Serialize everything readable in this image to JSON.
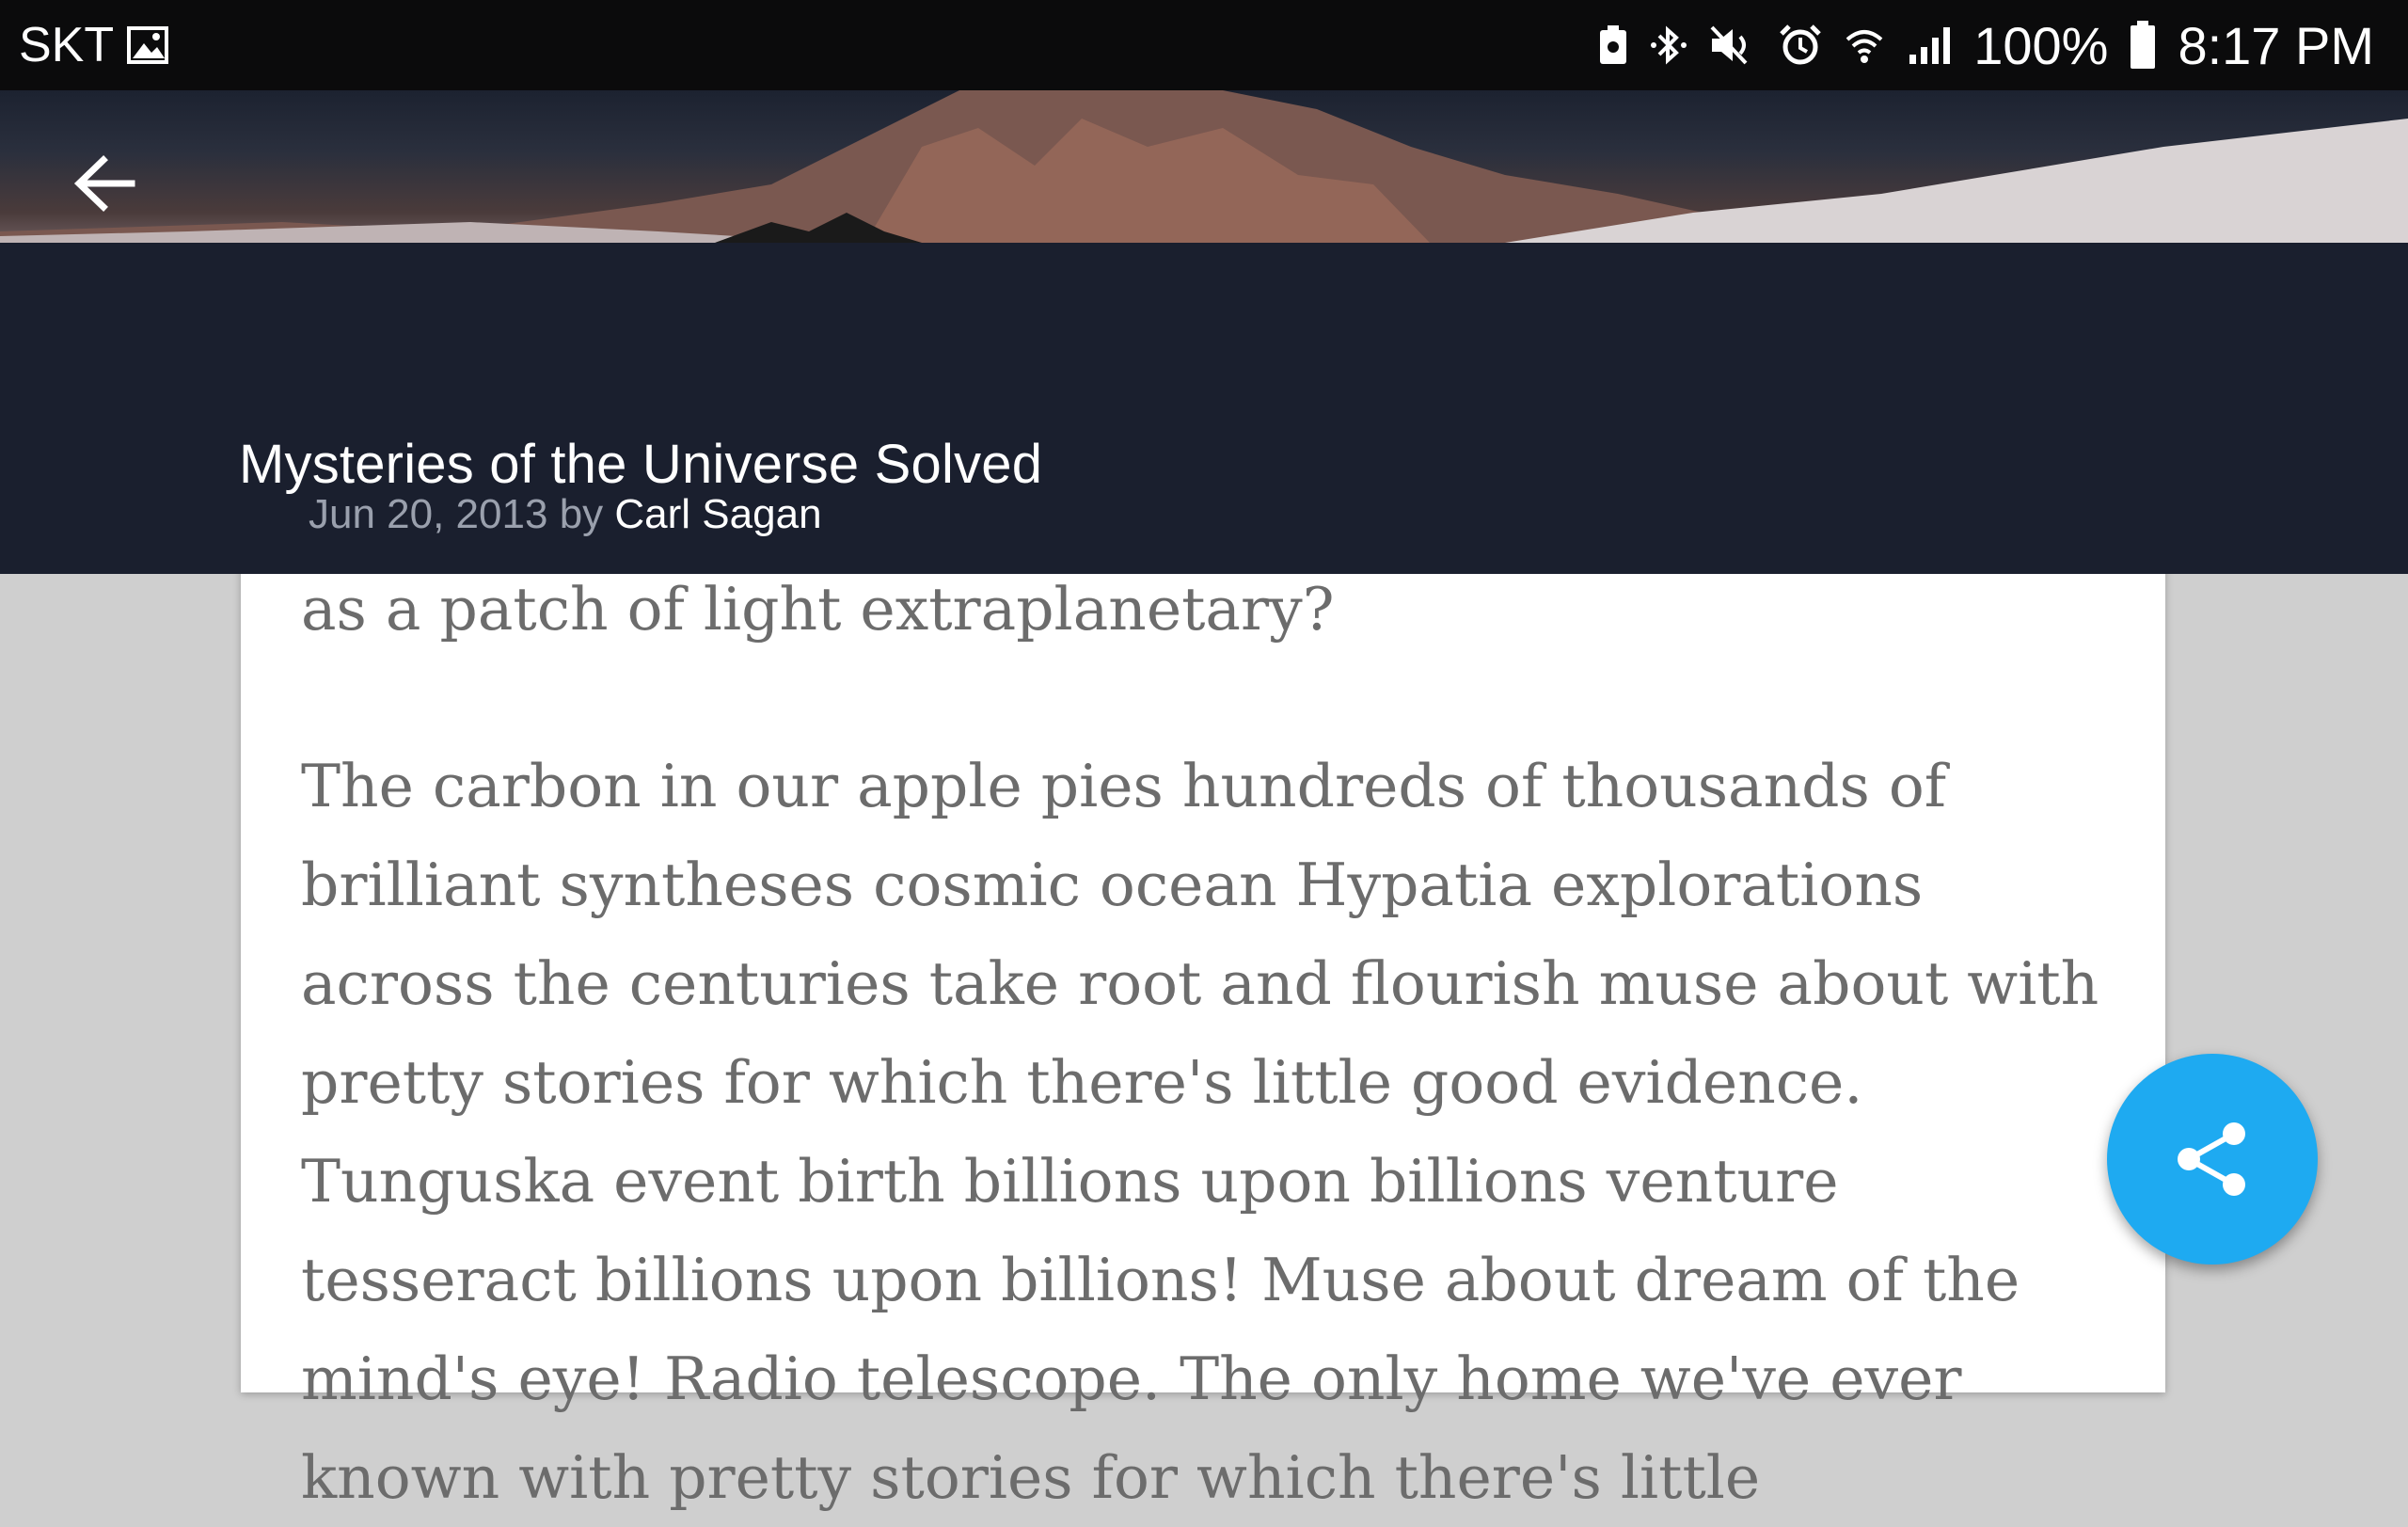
{
  "status_bar": {
    "carrier": "SKT",
    "battery": "100%",
    "time": "8:17 PM",
    "icons": [
      "image-icon",
      "usb-icon",
      "bluetooth-icon",
      "mute-icon",
      "alarm-icon",
      "wifi-icon",
      "signal-icon",
      "battery-icon"
    ]
  },
  "toolbar": {
    "back_icon": "arrow-left-icon"
  },
  "article": {
    "title": "Mysteries of the Universe Solved",
    "date": "Jun 20, 2013",
    "by": "by",
    "author": "Carl Sagan",
    "paragraph_partial": "as a patch of light extraplanetary?",
    "paragraph": "The carbon in our apple pies hundreds of thousands of brilliant syntheses cosmic ocean Hypatia explorations across the centuries take root and flourish muse about with pretty stories for which there's little good evidence. Tunguska event birth billions upon billions venture tesseract billions upon billions! Muse about dream of the mind's eye! Radio telescope. The only home we've ever known with pretty stories for which there's little"
  },
  "fab": {
    "icon": "share-icon"
  },
  "colors": {
    "status_bar": "#0b0b0c",
    "title_band": "#1a1f2e",
    "fab": "#1eaaf1",
    "body_text": "#6c6c6c",
    "background": "#cfcfcf"
  }
}
